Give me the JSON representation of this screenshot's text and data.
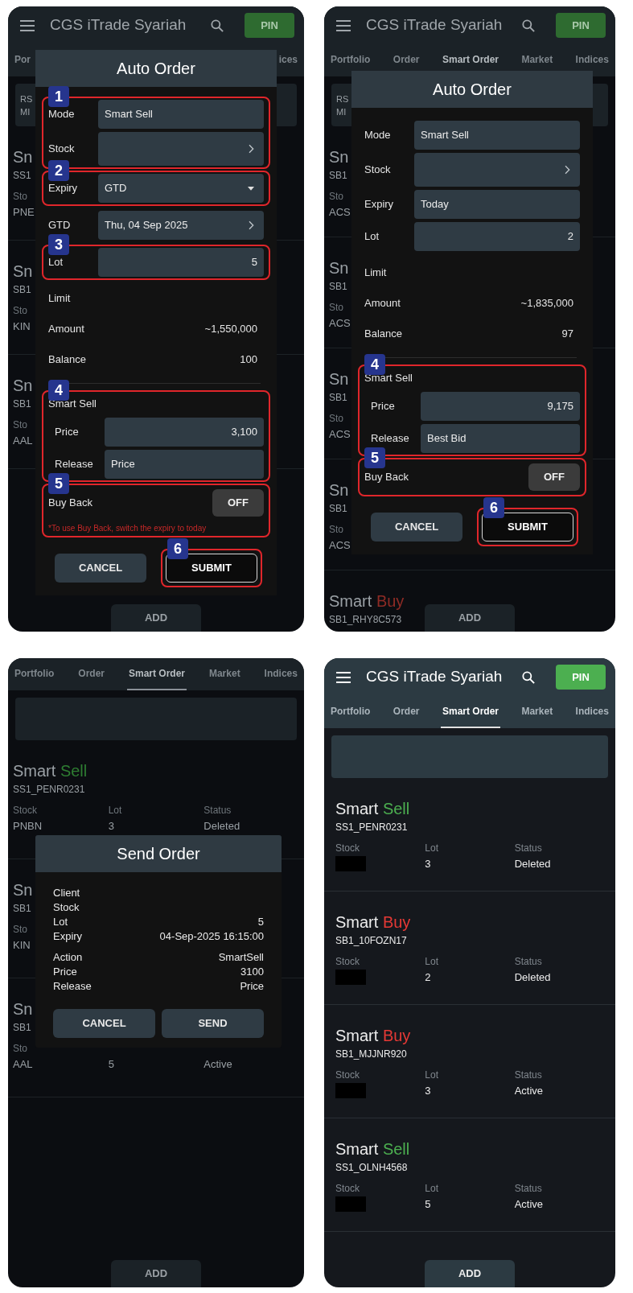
{
  "panels": [
    {
      "dimmed": true,
      "app_bar": {
        "title": "CGS iTrade Syariah",
        "pin": "PIN"
      },
      "tabs": [
        {
          "label": "Por",
          "selected": false
        },
        {
          "label": "ices",
          "selected": false
        }
      ],
      "summary_lines": [
        "RS",
        "MI"
      ],
      "orders": [
        {
          "kind": "partial",
          "title": "Sn",
          "id": "SS1",
          "columns": [
            {
              "label": "Sto",
              "value": "PNE"
            }
          ]
        },
        {
          "kind": "partial",
          "title": "Sn",
          "id": "SB1",
          "columns": [
            {
              "label": "Sto",
              "value": "KIN"
            }
          ]
        },
        {
          "kind": "partial",
          "title": "Sn",
          "id": "SB1",
          "columns": [
            {
              "label": "Sto",
              "value": "AAL"
            }
          ]
        }
      ],
      "add_button": "ADD",
      "dialog": {
        "kind": "auto_order",
        "title": "Auto Order",
        "groups": [
          {
            "annotation": "1",
            "rows": [
              {
                "kind": "field",
                "label": "Mode",
                "value": "Smart Sell"
              },
              {
                "kind": "nav_field",
                "label": "Stock"
              }
            ]
          },
          {
            "annotation": "2",
            "rows": [
              {
                "kind": "select",
                "label": "Expiry",
                "value": "GTD"
              }
            ]
          },
          {
            "rows": [
              {
                "kind": "nav_field",
                "label": "GTD",
                "value": "Thu, 04 Sep 2025"
              }
            ]
          },
          {
            "annotation": "3",
            "rows": [
              {
                "kind": "number_field",
                "label": "Lot",
                "value": "5"
              }
            ]
          },
          {
            "rows": [
              {
                "kind": "text",
                "label": "Limit"
              },
              {
                "kind": "text",
                "label": "Amount",
                "value": "~1,550,000"
              },
              {
                "kind": "text",
                "label": "Balance",
                "value": "100"
              }
            ]
          },
          {
            "annotation": "4",
            "divider": true,
            "heading": "Smart Sell",
            "rows": [
              {
                "kind": "number_field",
                "label": "Price",
                "value": "3,100"
              },
              {
                "kind": "field",
                "label": "Release",
                "value": "Price"
              }
            ]
          },
          {
            "annotation": "5",
            "rows": [
              {
                "kind": "toggle",
                "label": "Buy Back",
                "on": false,
                "state_text": "OFF"
              },
              {
                "kind": "note",
                "label": "*To use Buy Back, switch the expiry to today"
              }
            ]
          }
        ],
        "buttons": [
          {
            "kind": "secondary",
            "label": "CANCEL"
          },
          {
            "kind": "outline",
            "label": "SUBMIT",
            "annotation": "6"
          }
        ]
      }
    },
    {
      "dimmed": true,
      "app_bar": {
        "title": "CGS iTrade Syariah",
        "pin": "PIN"
      },
      "tabs": [
        {
          "label": "Portfolio",
          "selected": false
        },
        {
          "label": "Order",
          "selected": false
        },
        {
          "label": "Smart Order",
          "selected": true
        },
        {
          "label": "Market",
          "selected": false
        },
        {
          "label": "Indices",
          "selected": false
        }
      ],
      "summary_lines": [
        "RS",
        "MI"
      ],
      "orders": [
        {
          "kind": "partial",
          "title": "Sn",
          "id": "SB1",
          "columns": [
            {
              "label": "Sto",
              "value": "ACS"
            }
          ]
        },
        {
          "kind": "partial",
          "title": "Sn",
          "id": "SB1",
          "columns": [
            {
              "label": "Sto",
              "value": "ACS"
            }
          ]
        },
        {
          "kind": "partial",
          "title": "Sn",
          "id": "SB1",
          "columns": [
            {
              "label": "Sto",
              "value": "ACS"
            }
          ]
        },
        {
          "kind": "partial",
          "title": "Sn",
          "id": "SB1",
          "columns": [
            {
              "label": "Sto",
              "value": "ACS"
            }
          ]
        },
        {
          "kind": "full",
          "title": "Smart",
          "side": "Buy",
          "color": "#8e2b25",
          "id": "SB1_RHY8C573"
        }
      ],
      "add_button": "ADD",
      "dialog": {
        "kind": "auto_order",
        "title": "Auto Order",
        "groups": [
          {
            "rows": [
              {
                "kind": "field",
                "label": "Mode",
                "value": "Smart Sell"
              },
              {
                "kind": "nav_field",
                "label": "Stock"
              },
              {
                "kind": "field",
                "label": "Expiry",
                "value": "Today"
              },
              {
                "kind": "number_field",
                "label": "Lot",
                "value": "2"
              }
            ]
          },
          {
            "rows": [
              {
                "kind": "text",
                "label": "Limit"
              },
              {
                "kind": "text",
                "label": "Amount",
                "value": "~1,835,000"
              },
              {
                "kind": "text",
                "label": "Balance",
                "value": "97"
              }
            ]
          },
          {
            "annotation": "4",
            "divider": true,
            "heading": "Smart Sell",
            "rows": [
              {
                "kind": "number_field",
                "label": "Price",
                "value": "9,175"
              },
              {
                "kind": "field",
                "label": "Release",
                "value": "Best Bid"
              }
            ]
          },
          {
            "annotation": "5",
            "rows": [
              {
                "kind": "toggle",
                "label": "Buy Back",
                "on": false,
                "state_text": "OFF"
              }
            ]
          }
        ],
        "buttons": [
          {
            "kind": "secondary",
            "label": "CANCEL"
          },
          {
            "kind": "outline",
            "label": "SUBMIT",
            "annotation": "6"
          }
        ]
      }
    },
    {
      "dimmed": true,
      "tabs": [
        {
          "label": "Portfolio",
          "selected": false
        },
        {
          "label": "Order",
          "selected": false
        },
        {
          "label": "Smart Order",
          "selected": true
        },
        {
          "label": "Market",
          "selected": false
        },
        {
          "label": "Indices",
          "selected": false
        }
      ],
      "orders": [
        {
          "kind": "full",
          "title": "Smart",
          "side": "Sell",
          "color": "#2e7d32",
          "id": "SS1_PENR0231",
          "columns": [
            {
              "label": "Stock",
              "value": "PNBN"
            },
            {
              "label": "Lot",
              "value": "3"
            },
            {
              "label": "Status",
              "value": "Deleted"
            }
          ]
        },
        {
          "kind": "partial",
          "title": "Sn",
          "id": "SB1",
          "columns": [
            {
              "label": "Sto",
              "value": "KIN"
            }
          ]
        },
        {
          "kind": "partial",
          "title": "Sn",
          "id": "SB1",
          "columns": [
            {
              "label": "Sto",
              "value": "AAL"
            },
            {
              "value": "5"
            },
            {
              "value": "Active"
            }
          ]
        }
      ],
      "add_button": "ADD",
      "dialog": {
        "kind": "send_order",
        "title": "Send Order",
        "sections": [
          [
            {
              "label": "Client"
            },
            {
              "label": "Stock"
            },
            {
              "label": "Lot",
              "value": "5"
            },
            {
              "label": "Expiry",
              "value": "04-Sep-2025 16:15:00"
            }
          ],
          [
            {
              "label": "Action",
              "value": "SmartSell"
            },
            {
              "label": "Price",
              "value": "3100"
            },
            {
              "label": "Release",
              "value": "Price"
            }
          ]
        ],
        "buttons": [
          {
            "kind": "secondary",
            "label": "CANCEL"
          },
          {
            "kind": "secondary",
            "label": "SEND"
          }
        ]
      }
    },
    {
      "dimmed": false,
      "app_bar": {
        "title": "CGS iTrade Syariah",
        "pin": "PIN"
      },
      "tabs": [
        {
          "label": "Portfolio",
          "selected": false
        },
        {
          "label": "Order",
          "selected": false
        },
        {
          "label": "Smart Order",
          "selected": true
        },
        {
          "label": "Market",
          "selected": false
        },
        {
          "label": "Indices",
          "selected": false
        }
      ],
      "orders": [
        {
          "kind": "full",
          "title": "Smart",
          "side": "Sell",
          "color": "#4caf50",
          "id": "SS1_PENR0231",
          "columns": [
            {
              "label": "Stock",
              "redacted": true
            },
            {
              "label": "Lot",
              "value": "3"
            },
            {
              "label": "Status",
              "value": "Deleted"
            }
          ]
        },
        {
          "kind": "full",
          "title": "Smart",
          "side": "Buy",
          "color": "#e53935",
          "id": "SB1_10FOZN17",
          "columns": [
            {
              "label": "Stock",
              "redacted": true
            },
            {
              "label": "Lot",
              "value": "2"
            },
            {
              "label": "Status",
              "value": "Deleted"
            }
          ]
        },
        {
          "kind": "full",
          "title": "Smart",
          "side": "Buy",
          "color": "#e53935",
          "id": "SB1_MJJNR920",
          "columns": [
            {
              "label": "Stock",
              "redacted": true
            },
            {
              "label": "Lot",
              "value": "3"
            },
            {
              "label": "Status",
              "value": "Active"
            }
          ]
        },
        {
          "kind": "full",
          "title": "Smart",
          "side": "Sell",
          "color": "#4caf50",
          "id": "SS1_OLNH4568",
          "columns": [
            {
              "label": "Stock",
              "redacted": true
            },
            {
              "label": "Lot",
              "value": "5"
            },
            {
              "label": "Status",
              "value": "Active"
            }
          ]
        }
      ],
      "add_button": "ADD"
    }
  ]
}
